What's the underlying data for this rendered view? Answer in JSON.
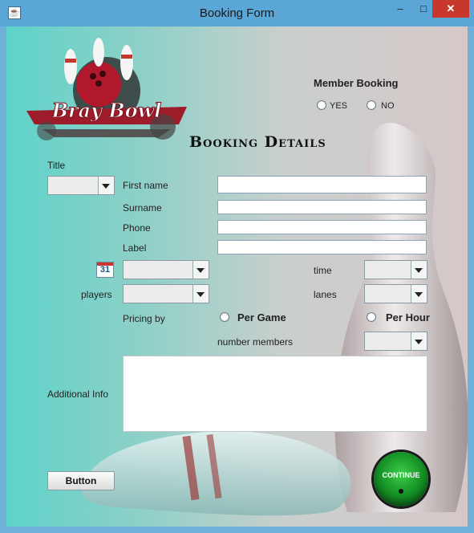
{
  "window": {
    "title": "Booking Form",
    "app_icon": "java-cup-icon",
    "controls": {
      "minimize": "–",
      "maximize": "□",
      "close": "✕"
    }
  },
  "logo": {
    "text": "Bray Bowl",
    "icon": "bowling-logo-icon"
  },
  "member_booking": {
    "label": "Member Booking",
    "yes_label": "YES",
    "no_label": "NO"
  },
  "heading": "Booking Details",
  "form": {
    "title_label": "Title",
    "title_value": "",
    "first_name_label": "First name",
    "first_name_value": "",
    "surname_label": "Surname",
    "surname_value": "",
    "phone_label": "Phone",
    "phone_value": "",
    "label_label": "Label",
    "label_value": "",
    "calendar_icon_text": "31",
    "date_value": "",
    "time_label": "time",
    "time_value": "",
    "players_label": "players",
    "players_value": "",
    "lanes_label": "lanes",
    "lanes_value": "",
    "pricing_label": "Pricing by",
    "per_game_label": "Per Game",
    "per_hour_label": "Per Hour",
    "number_members_label": "number members",
    "number_members_value": "",
    "additional_info_label": "Additional Info",
    "additional_info_value": ""
  },
  "buttons": {
    "button_label": "Button",
    "continue_label": "CONTINUE"
  },
  "colors": {
    "titlebar": "#5aa6d6",
    "close": "#c8372d",
    "background_left": "#5ed3c9",
    "background_right": "#d6c8c9",
    "continue_green": "#128a22"
  }
}
